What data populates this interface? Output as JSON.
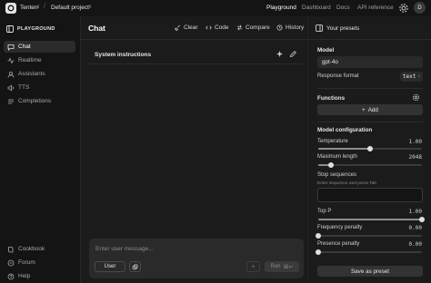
{
  "topbar": {
    "org": "Tenten",
    "separator": "/",
    "project": "Default project",
    "nav": [
      "Playground",
      "Dashboard",
      "Docs",
      "API reference"
    ],
    "user_initial": "D"
  },
  "sidebar": {
    "header": "PLAYGROUND",
    "items": [
      {
        "label": "Chat",
        "icon": "chat-icon"
      },
      {
        "label": "Realtime",
        "icon": "realtime-icon"
      },
      {
        "label": "Assistants",
        "icon": "assistants-icon"
      },
      {
        "label": "TTS",
        "icon": "tts-icon"
      },
      {
        "label": "Completions",
        "icon": "completions-icon"
      }
    ],
    "footer": [
      {
        "label": "Cookbook",
        "icon": "cookbook-icon"
      },
      {
        "label": "Forum",
        "icon": "forum-icon"
      },
      {
        "label": "Help",
        "icon": "help-icon"
      }
    ]
  },
  "main": {
    "title": "Chat",
    "toolbar": {
      "clear": "Clear",
      "code": "Code",
      "compare": "Compare",
      "history": "History"
    },
    "system_label": "System instructions",
    "composer": {
      "placeholder": "Enter user message...",
      "role": "User",
      "add": "+",
      "run": "Run",
      "run_shortcut": "⌘↵"
    }
  },
  "panel": {
    "header": "Your presets",
    "model_label": "Model",
    "model_value": "gpt-4o",
    "response_format_label": "Response format",
    "response_format_value": "text",
    "functions_label": "Functions",
    "add_function": "Add",
    "config_label": "Model configuration",
    "temperature": {
      "label": "Temperature",
      "value": "1.00",
      "fraction": 0.5
    },
    "max_length": {
      "label": "Maximum length",
      "value": "2048",
      "fraction": 0.12
    },
    "stop_sequences_label": "Stop sequences",
    "stop_sequences_placeholder": "Enter sequence and press Tab",
    "top_p": {
      "label": "Top P",
      "value": "1.00",
      "fraction": 1.0
    },
    "frequency_penalty": {
      "label": "Frequency penalty",
      "value": "0.00",
      "fraction": 0.0
    },
    "presence_penalty": {
      "label": "Presence penalty",
      "value": "0.00",
      "fraction": 0.0
    },
    "save_preset": "Save as preset"
  }
}
